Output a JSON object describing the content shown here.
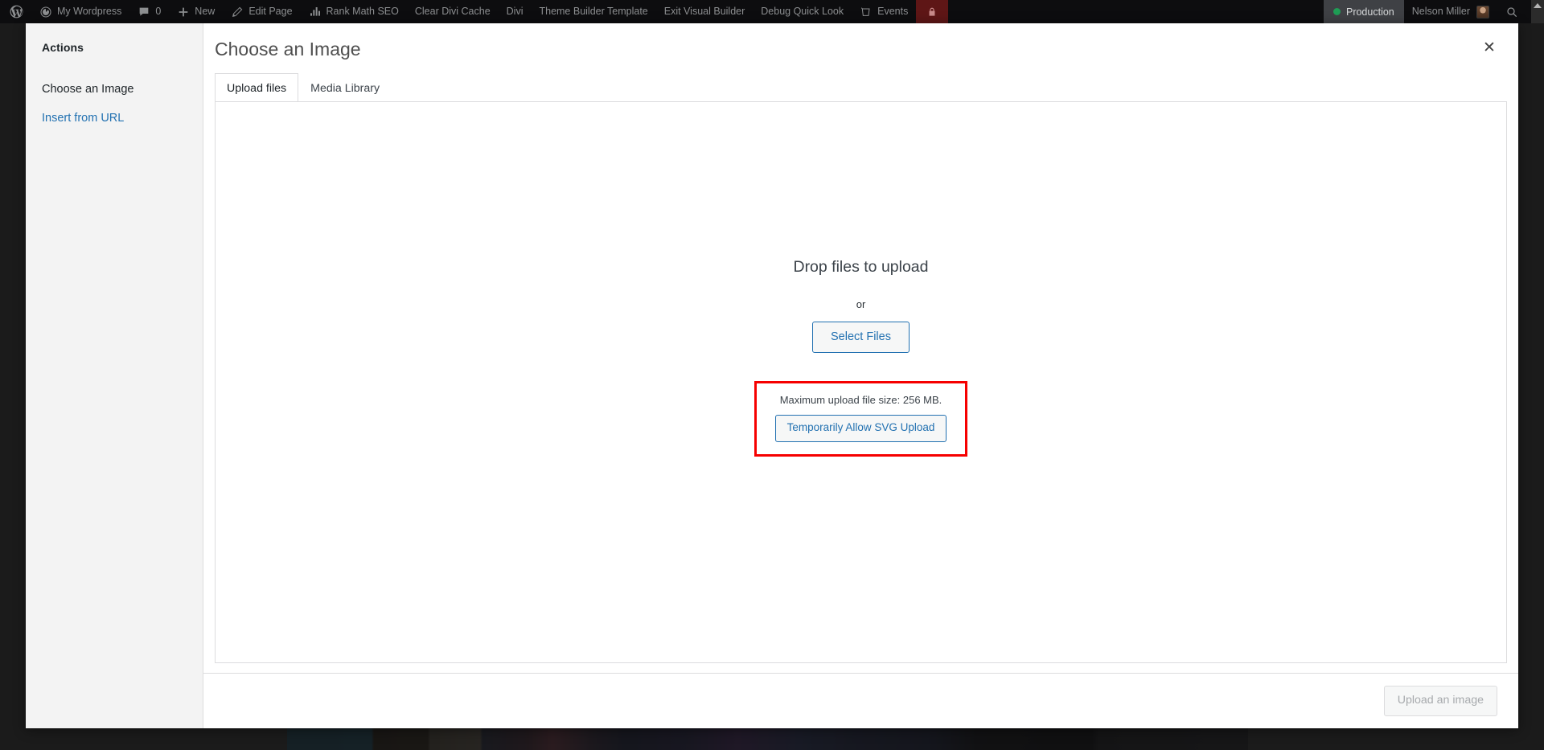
{
  "adminbar": {
    "items": [
      {
        "name": "wp-logo",
        "icon": "wordpress-icon",
        "label": ""
      },
      {
        "name": "site-name",
        "icon": "dashboard-icon",
        "label": "My Wordpress"
      },
      {
        "name": "comments",
        "icon": "comment-bubble-icon",
        "label": "0"
      },
      {
        "name": "new-content",
        "icon": "plus-icon",
        "label": "New"
      },
      {
        "name": "edit-page",
        "icon": "pencil-icon",
        "label": "Edit Page"
      },
      {
        "name": "rank-math-seo",
        "icon": "rank-math-icon",
        "label": "Rank Math SEO"
      },
      {
        "name": "clear-divi-cache",
        "icon": "",
        "label": "Clear Divi Cache"
      },
      {
        "name": "divi",
        "icon": "",
        "label": "Divi"
      },
      {
        "name": "theme-builder-template",
        "icon": "",
        "label": "Theme Builder Template"
      },
      {
        "name": "exit-visual-builder",
        "icon": "",
        "label": "Exit Visual Builder"
      },
      {
        "name": "debug-quick-look",
        "icon": "",
        "label": "Debug Quick Look"
      },
      {
        "name": "events",
        "icon": "events-icon",
        "label": "Events"
      }
    ],
    "lock": {
      "icon": "lock-icon"
    },
    "environment": {
      "label": "Production",
      "dot_color": "#1f9d55"
    },
    "account": {
      "label": "Nelson Miller",
      "avatar": "user-avatar"
    },
    "search": {
      "icon": "search-icon"
    }
  },
  "modal": {
    "title": "Choose an Image",
    "close_label": "✕",
    "sidebar": {
      "heading": "Actions",
      "items": [
        {
          "label": "Choose an Image",
          "state": "active"
        },
        {
          "label": "Insert from URL",
          "state": "link"
        }
      ]
    },
    "tabs": [
      {
        "label": "Upload files",
        "active": true
      },
      {
        "label": "Media Library",
        "active": false
      }
    ],
    "uploader": {
      "drop_instructions": "Drop files to upload",
      "or_label": "or",
      "select_files_label": "Select Files",
      "max_upload_size": "Maximum upload file size: 256 MB.",
      "allow_svg_label": "Temporarily Allow SVG Upload",
      "highlight_color": "#f60000"
    },
    "footer": {
      "primary_button": "Upload an image",
      "primary_button_disabled": true
    }
  }
}
